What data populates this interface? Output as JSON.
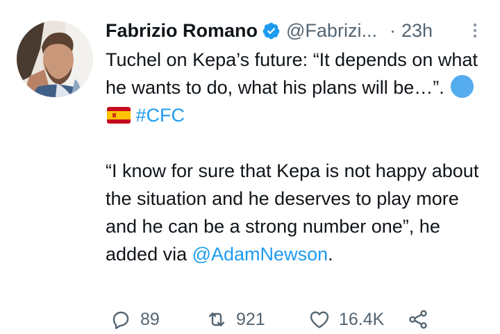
{
  "tweet": {
    "author_name": "Fabrizio Romano",
    "handle": "@Fabrizi...",
    "separator": "·",
    "time": "23h",
    "text": {
      "p1_before": "Tuchel on Kepa’s future: “It depends on what he wants to do, what his plans will be…”. ",
      "hashtag": "#CFC",
      "p2": "“I know for sure that Kepa is not happy about the situation and he deserves to play more and he can be a strong number one”, he added via ",
      "mention": "@AdamNewson",
      "p2_end": "."
    },
    "emojis": [
      "blue-circle",
      "spain-flag"
    ],
    "actions": {
      "replies": "89",
      "retweets": "921",
      "likes": "16.4K"
    }
  },
  "colors": {
    "text": "#0f1419",
    "secondary": "#536471",
    "link": "#1d9bf0",
    "verified": "#1d9bf0"
  }
}
